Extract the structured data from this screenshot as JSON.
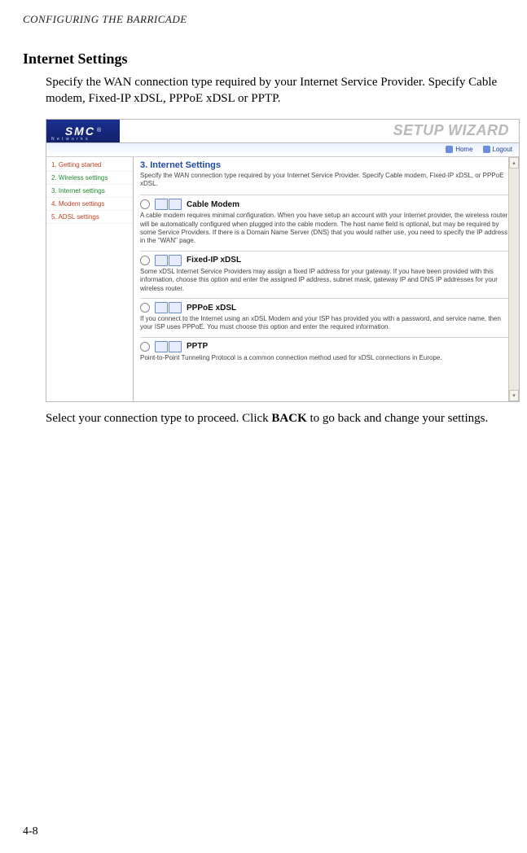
{
  "running_head": "CONFIGURING THE BARRICADE",
  "page_number": "4-8",
  "section_title": "Internet Settings",
  "intro": "Specify the WAN connection type required by your Internet Service Provider. Specify Cable modem, Fixed-IP xDSL, PPPoE xDSL or PPTP.",
  "outro_pre": "Select your connection type to proceed. Click ",
  "outro_bold": "BACK",
  "outro_post": " to go back and change your settings.",
  "shot": {
    "logo": "SMC",
    "logo_reg": "®",
    "logo_sub": "N e t w o r k s",
    "banner_title": "SETUP WIZARD",
    "topbar": {
      "home": "Home",
      "logout": "Logout"
    },
    "nav": [
      {
        "label": "1. Getting started",
        "cls": "nav-red"
      },
      {
        "label": "2. Wireless settings",
        "cls": "nav-green"
      },
      {
        "label": "3. Internet settings",
        "cls": "nav-green"
      },
      {
        "label": "4. Modem settings",
        "cls": "nav-red"
      },
      {
        "label": "5. ADSL settings",
        "cls": "nav-red"
      }
    ],
    "panel_title": "3. Internet Settings",
    "panel_desc": "Specify the WAN connection type required by your Internet Service Provider. Specify Cable modem, Fixed-IP xDSL, or PPPoE xDSL.",
    "options": [
      {
        "label": "Cable Modem",
        "desc": "A cable modem requires minimal configuration. When you have setup an account with your Internet provider, the wireless router will be automatically configured when plugged into the cable modem. The host name field is optional, but may be required by some Service Providers. If there is a Domain Name Server (DNS) that you would rather use, you need to specify the IP address in the \"WAN\" page."
      },
      {
        "label": "Fixed-IP xDSL",
        "desc": "Some xDSL Internet Service Providers may assign a fixed IP address for your gateway. If you have been provided with this information, choose this option and enter the assigned IP address, subnet mask, gateway IP and DNS IP addresses for your wireless router."
      },
      {
        "label": "PPPoE xDSL",
        "desc": "If you connect to the Internet using an xDSL Modem and your ISP has provided you with a password, and service name, then your ISP uses PPPoE. You must choose this option and enter the required information."
      },
      {
        "label": "PPTP",
        "desc": "Point-to-Point Tunneling Protocol is a common connection method used for xDSL connections in Europe."
      }
    ]
  }
}
